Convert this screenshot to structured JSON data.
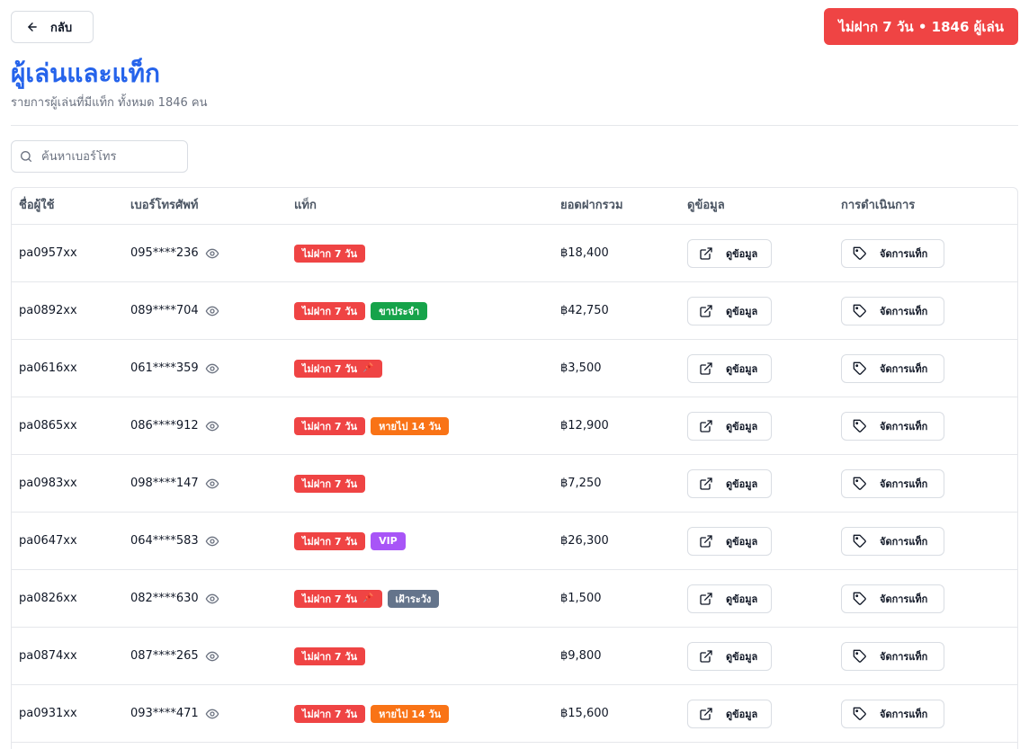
{
  "header": {
    "back_label": "กลับ",
    "alert_label": "ไม่ฝาก 7 วัน • 1846 ผู้เล่น",
    "title": "ผู้เล่นและแท็ก",
    "subtitle": "รายการผู้เล่นที่มีแท็ก ทั้งหมด 1846 คน"
  },
  "search": {
    "placeholder": "ค้นหาเบอร์โทร",
    "value": ""
  },
  "table": {
    "headers": {
      "username": "ชื่อผู้ใช้",
      "phone": "เบอร์โทรศัพท์",
      "tags": "แท็ก",
      "total": "ยอดฝากรวม",
      "view": "ดูข้อมูล",
      "actions": "การดำเนินการ"
    },
    "view_button_label": "ดูข้อมูล",
    "manage_button_label": "จัดการแท็ก",
    "rows": [
      {
        "username": "pa0957xx",
        "phone": "095****236",
        "total": "฿18,400",
        "tags": [
          {
            "label": "ไม่ฝาก 7 วัน",
            "color": "red"
          }
        ]
      },
      {
        "username": "pa0892xx",
        "phone": "089****704",
        "total": "฿42,750",
        "tags": [
          {
            "label": "ไม่ฝาก 7 วัน",
            "color": "red"
          },
          {
            "label": "ขาประจำ",
            "color": "green"
          }
        ]
      },
      {
        "username": "pa0616xx",
        "phone": "061****359",
        "total": "฿3,500",
        "tags": [
          {
            "label": "ไม่ฝาก 7 วัน",
            "color": "red",
            "pinned": true
          }
        ]
      },
      {
        "username": "pa0865xx",
        "phone": "086****912",
        "total": "฿12,900",
        "tags": [
          {
            "label": "ไม่ฝาก 7 วัน",
            "color": "red"
          },
          {
            "label": "หายไป 14 วัน",
            "color": "orange"
          }
        ]
      },
      {
        "username": "pa0983xx",
        "phone": "098****147",
        "total": "฿7,250",
        "tags": [
          {
            "label": "ไม่ฝาก 7 วัน",
            "color": "red"
          }
        ]
      },
      {
        "username": "pa0647xx",
        "phone": "064****583",
        "total": "฿26,300",
        "tags": [
          {
            "label": "ไม่ฝาก 7 วัน",
            "color": "red"
          },
          {
            "label": "VIP",
            "color": "purple"
          }
        ]
      },
      {
        "username": "pa0826xx",
        "phone": "082****630",
        "total": "฿1,500",
        "tags": [
          {
            "label": "ไม่ฝาก 7 วัน",
            "color": "red",
            "pinned": true
          },
          {
            "label": "เฝ้าระวัง",
            "color": "slate"
          }
        ]
      },
      {
        "username": "pa0874xx",
        "phone": "087****265",
        "total": "฿9,800",
        "tags": [
          {
            "label": "ไม่ฝาก 7 วัน",
            "color": "red"
          }
        ]
      },
      {
        "username": "pa0931xx",
        "phone": "093****471",
        "total": "฿15,600",
        "tags": [
          {
            "label": "ไม่ฝาก 7 วัน",
            "color": "red"
          },
          {
            "label": "หายไป 14 วัน",
            "color": "orange"
          }
        ]
      }
    ]
  },
  "colors": {
    "accent": "#2563eb",
    "danger": "#ef4444",
    "green": "#16a34a",
    "orange": "#f97316",
    "purple": "#a855f7",
    "slate": "#64748b"
  },
  "icons": {
    "back": "arrow-left-icon",
    "search": "search-icon",
    "reveal": "eye-icon",
    "pinned": "pushpin-icon",
    "view": "external-link-icon",
    "manage": "tag-icon"
  }
}
